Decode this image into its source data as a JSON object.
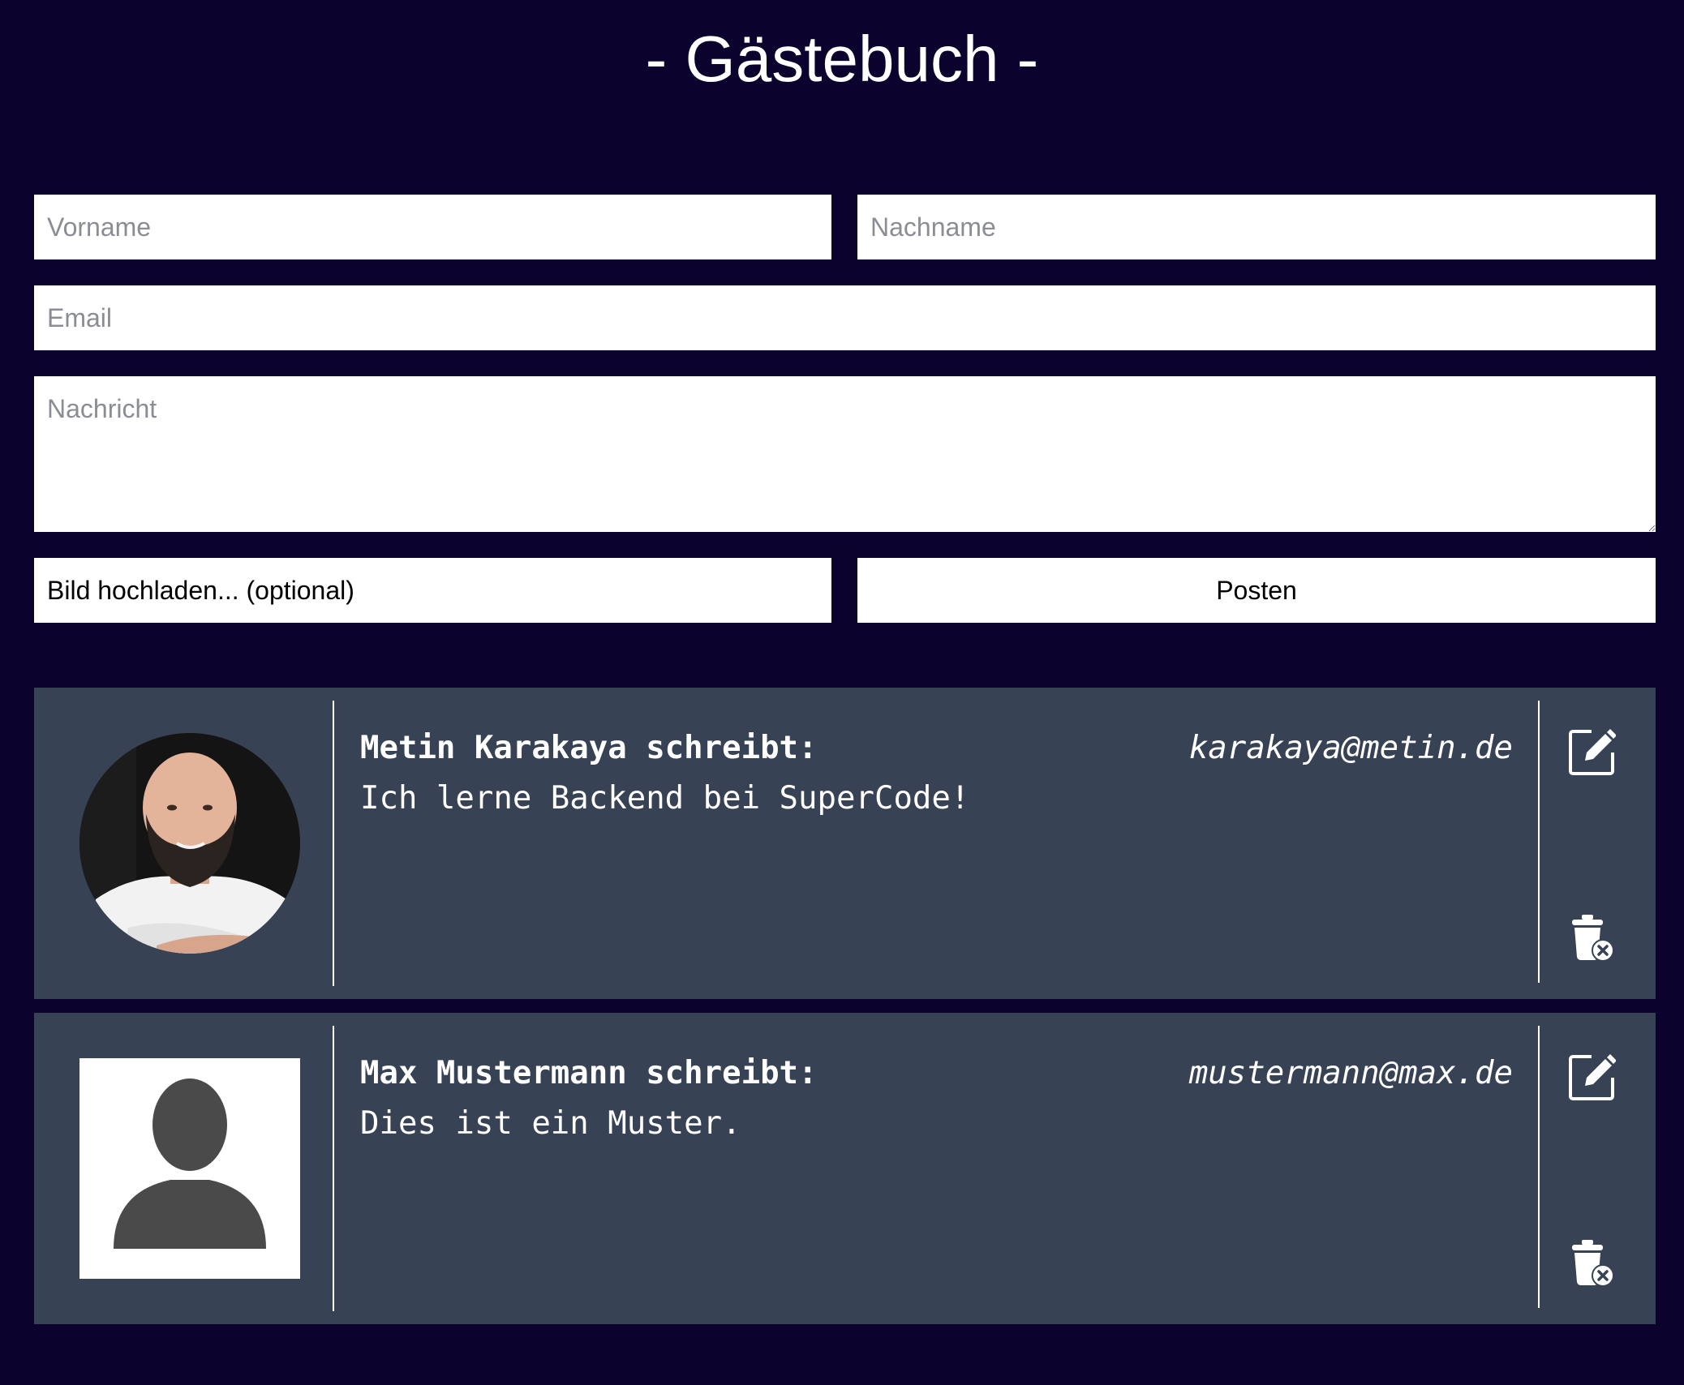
{
  "page": {
    "title": "- Gästebuch -"
  },
  "form": {
    "vorname_placeholder": "Vorname",
    "nachname_placeholder": "Nachname",
    "email_placeholder": "Email",
    "nachricht_placeholder": "Nachricht",
    "upload_label": "Bild hochladen... (optional)",
    "submit_label": "Posten"
  },
  "entries": [
    {
      "author": "Metin Karakaya schreibt:",
      "email": "karakaya@metin.de",
      "message": "Ich lerne Backend bei SuperCode!",
      "avatar": "profile-photo",
      "edit_icon": "edit-icon",
      "delete_icon": "trash-icon"
    },
    {
      "author": "Max Mustermann schreibt:",
      "email": "mustermann@max.de",
      "message": "Dies ist ein Muster.",
      "avatar": "default-avatar-silhouette",
      "edit_icon": "edit-icon",
      "delete_icon": "trash-icon"
    }
  ],
  "colors": {
    "background": "#0b032d",
    "entry_background": "#374254",
    "text": "#ffffff",
    "placeholder": "#8a8d93"
  }
}
